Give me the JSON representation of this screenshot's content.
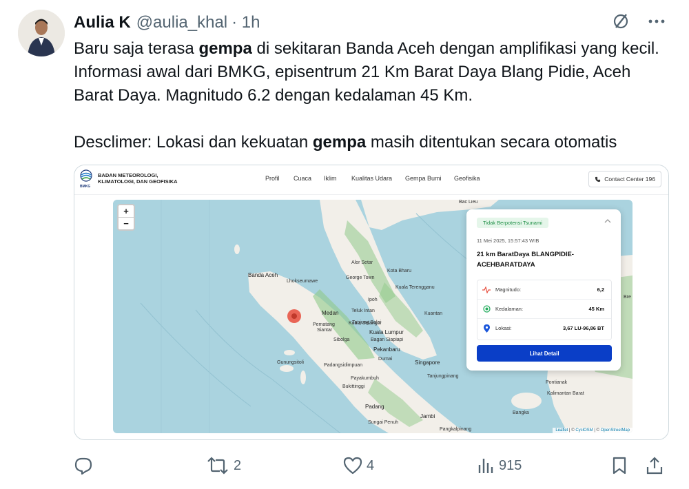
{
  "tweet": {
    "author_name": "Aulia K",
    "handle": "@aulia_khal",
    "time": "· 1h",
    "text_line1_pre": "Baru saja terasa ",
    "text_line1_bold": "gempa",
    "text_line1_post": " di sekitaran Banda Aceh dengan amplifikasi yang kecil. Informasi awal dari BMKG, episentrum 21 Km Barat Daya Blang Pidie, Aceh Barat Daya. Magnitudo 6.2 dengan kedalaman 45 Km.",
    "text_line2_pre": "Desclimer: Lokasi dan kekuatan ",
    "text_line2_bold": "gempa",
    "text_line2_post": " masih ditentukan secara otomatis"
  },
  "embed": {
    "logo_label": "BMKG",
    "agency_line1": "BADAN METEOROLOGI,",
    "agency_line2": "KLIMATOLOGI, DAN GEOFISIKA",
    "nav": [
      "Profil",
      "Cuaca",
      "Iklim",
      "Kualitas Udara",
      "Gempa Bumi",
      "Geofisika"
    ],
    "contact": "Contact Center 196",
    "zoom_in": "+",
    "zoom_out": "−",
    "map_labels": {
      "banda_aceh": "Banda Aceh",
      "medan": "Medan",
      "pematang": "Pematang",
      "siantar": "Siantar",
      "padangsidempuan": "Padangsidimpuan",
      "gunungsitoli": "Gunungsitoli",
      "padang": "Padang",
      "jambi": "Jambi",
      "pekanbaru": "Pekanbaru",
      "dumai": "Dumai",
      "singapore": "Singapore",
      "tanjungpinang": "Tanjungpinang",
      "kuala_lumpur": "Kuala Lumpur",
      "george_town": "George Town",
      "alor_setar": "Alor Setar",
      "kota_bharu": "Kota Bharu",
      "kuala_terengganu": "Kuala Terengganu",
      "ipoh": "Ipoh",
      "kuantan": "Kuantan",
      "teluk_intan": "Teluk Intan",
      "pontianak": "Pontianak",
      "pangkalpinang": "Pangkalpinang",
      "bac_lieu": "Bac Lieu",
      "lhokseumawe": "Lhokseumawe",
      "bangka": "Bangka",
      "sibolga": "Sibolga",
      "payakumbuh": "Payakumbuh",
      "bukittinggi": "Bukittinggi",
      "sungai_penuh": "Sungai Penuh",
      "kuala_selangor": "Kuala Selangor",
      "tanjung_balai": "Tanjung Balai",
      "bagan_siapiapi": "Bagan Siapiapi",
      "kalimantan": "Kalimantan Barat",
      "bre": "Bre"
    },
    "popup": {
      "badge": "Tidak Berpotensi Tsunami",
      "datetime": "11 Mei 2025, 15:57:43 WIB",
      "location_title": "21 km BaratDaya BLANGPIDIE-ACEHBARATDAYA",
      "magnitude_label": "Magnitudo:",
      "magnitude_value": "6,2",
      "depth_label": "Kedalaman:",
      "depth_value": "45 Km",
      "location_label": "Lokasi:",
      "location_value": "3,67 LU-96,86 BT",
      "detail_button": "Lihat Detail"
    },
    "attribution": {
      "leaflet": "Leaflet",
      "cyclosm": "CyclOSM",
      "osm": "OpenStreetMap"
    }
  },
  "actions": {
    "replies": "",
    "retweets": "2",
    "likes": "4",
    "views": "915"
  },
  "colors": {
    "sea": "#aad3df",
    "land": "#f2efe9",
    "forest": "#8fc98a",
    "badge_bg": "#e5f6ea",
    "badge_text": "#1f8f46",
    "button": "#0a3ec7",
    "epicenter": "#e74c3c"
  },
  "icons": [
    "grok-icon",
    "more-icon",
    "reply-icon",
    "retweet-icon",
    "like-icon",
    "views-icon",
    "bookmark-icon",
    "share-icon",
    "phone-icon",
    "pulse-icon",
    "target-icon",
    "pin-icon",
    "chevron-up-icon"
  ]
}
